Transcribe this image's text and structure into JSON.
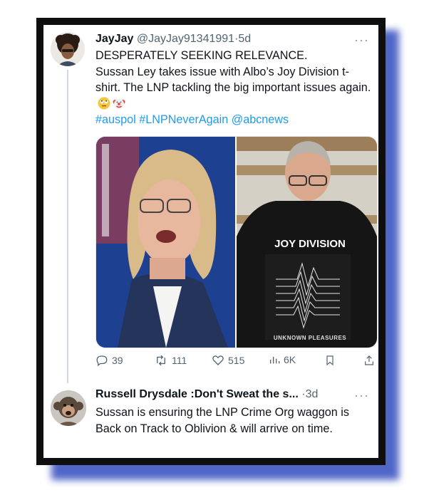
{
  "tweet": {
    "author_name": "JayJay",
    "author_handle": "@JayJay91341991",
    "separator": "·",
    "time": "5d",
    "more": "···",
    "line1": "DESPERATELY SEEKING RELEVANCE.",
    "line2": "Sussan Ley takes issue with Albo’s Joy Division t-shirt. The LNP tackling the big important issues again.",
    "hashtags": "#auspol #LNPNeverAgain @abcnews",
    "shirt_text": "JOY DIVISION",
    "shirt_subtext": "UNKNOWN PLEASURES",
    "replies": "39",
    "retweets": "111",
    "likes": "515",
    "views": "6K"
  },
  "reply": {
    "author_name": "Russell Drysdale :Don't Sweat the s...",
    "separator": "·",
    "time": "3d",
    "more": "···",
    "text": "Sussan is ensuring the LNP Crime Org waggon is Back on Track to Oblivion & will arrive on time."
  },
  "colors": {
    "link": "#1d9bf0",
    "frame_shadow": "#3f57c2",
    "text": "#0f1419",
    "muted": "#536471"
  },
  "icons": [
    "reply-icon",
    "retweet-icon",
    "like-icon",
    "views-icon",
    "bookmark-icon",
    "share-icon",
    "more-icon",
    "rolling-eyes-emoji-icon",
    "clown-emoji-icon"
  ]
}
